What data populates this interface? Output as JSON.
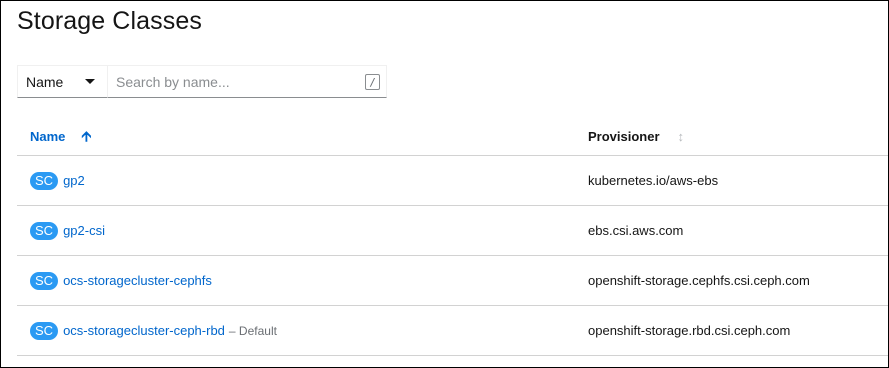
{
  "page": {
    "title": "Storage Classes"
  },
  "filter": {
    "selected": "Name",
    "placeholder": "Search by name...",
    "shortcut": "/"
  },
  "table": {
    "columns": {
      "name": "Name",
      "provisioner": "Provisioner"
    },
    "sort": {
      "column": "name",
      "direction": "ascending"
    },
    "rows": [
      {
        "badge": "SC",
        "name": "gp2",
        "default_label": "",
        "provisioner": "kubernetes.io/aws-ebs"
      },
      {
        "badge": "SC",
        "name": "gp2-csi",
        "default_label": "",
        "provisioner": "ebs.csi.aws.com"
      },
      {
        "badge": "SC",
        "name": "ocs-storagecluster-cephfs",
        "default_label": "",
        "provisioner": "openshift-storage.cephfs.csi.ceph.com"
      },
      {
        "badge": "SC",
        "name": "ocs-storagecluster-ceph-rbd",
        "default_label": "– Default",
        "provisioner": "openshift-storage.rbd.csi.ceph.com"
      }
    ]
  },
  "colors": {
    "link": "#0066cc",
    "badge_bg": "#2b9af3",
    "text": "#151515",
    "muted": "#6a6e73",
    "divider": "#d2d2d2"
  }
}
